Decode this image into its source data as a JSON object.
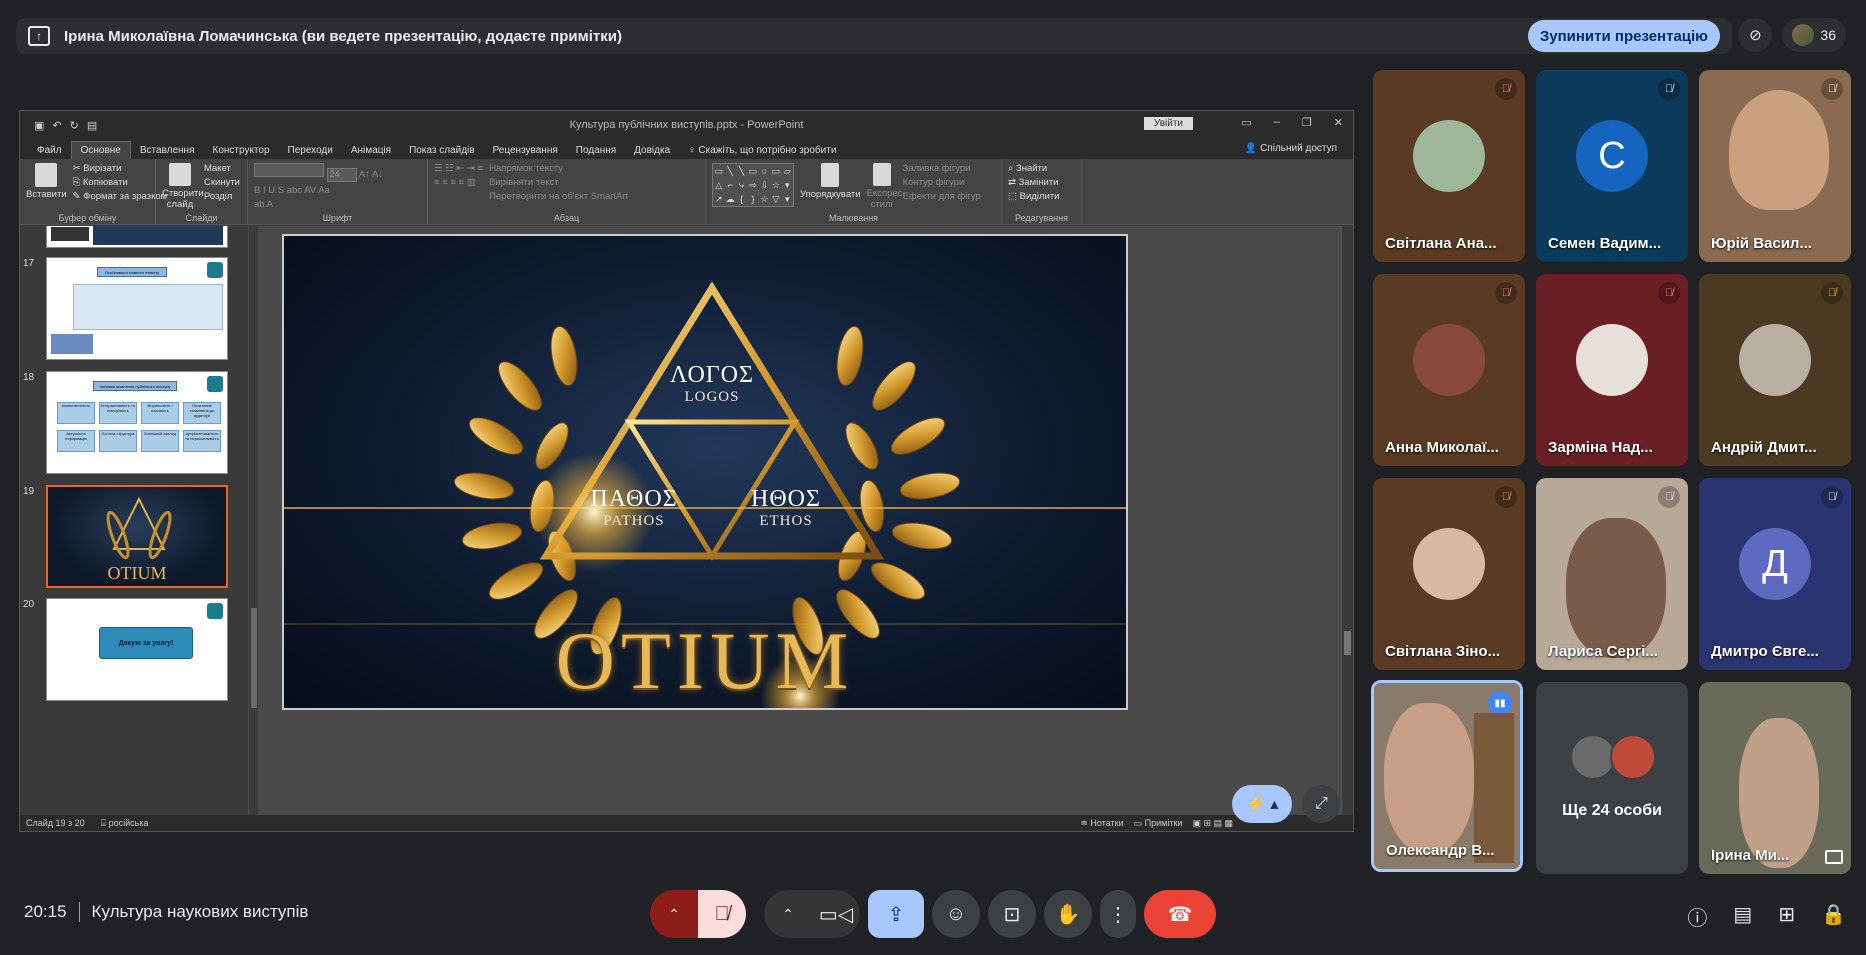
{
  "presentation_bar": {
    "text": "Ірина Миколаївна Ломачинська (ви ведете презентацію, додаєте примітки)",
    "stop_button": "Зупинити презентацію",
    "participant_count": "36"
  },
  "powerpoint": {
    "title": "Культура публічних виступів.pptx - PowerPoint",
    "sign_in": "Увійти",
    "tabs": [
      "Файл",
      "Основне",
      "Вставлення",
      "Конструктор",
      "Переходи",
      "Анімація",
      "Показ слайдів",
      "Рецензування",
      "Подання",
      "Довідка",
      "Скажіть, що потрібно зробити"
    ],
    "active_tab": "Основне",
    "share": "Спільний доступ",
    "ribbon": {
      "clipboard": {
        "paste": "Вставити",
        "cut": "Вирізати",
        "copy": "Копіювати",
        "format": "Формат за зразком",
        "group": "Буфер обміну"
      },
      "slides": {
        "new": "Створити слайд",
        "layout": "Макет",
        "reset": "Скинути",
        "section": "Розділ",
        "group": "Слайди"
      },
      "font": {
        "size": "24",
        "group": "Шрифт"
      },
      "paragraph": {
        "dir": "Напрямок тексту",
        "align": "Вирівняти текст",
        "smartart": "Перетворити на об'єкт SmartArt",
        "group": "Абзац"
      },
      "drawing": {
        "arrange": "Упорядкувати",
        "styles": "Експрес-стилі",
        "fill": "Заливка фігури",
        "outline": "Контур фігури",
        "effects": "Ефекти для фігур",
        "group": "Малювання"
      },
      "editing": {
        "find": "Знайти",
        "replace": "Замінити",
        "select": "Виділити",
        "group": "Редагування"
      }
    },
    "thumbnails": [
      {
        "num": "17",
        "title": "Особливості мовного етикету"
      },
      {
        "num": "18",
        "title": "Чинники мовлення публічного виступу",
        "cells": [
          "Компетентність",
          "Інтерактивність та емоційність",
          "Візуальність і наочність",
          "Позитивне ставлення до аудиторії",
          "Актуальна інформація",
          "Логічна структура",
          "Зовнішній вигляд",
          "Аргументованість та переконливість"
        ]
      },
      {
        "num": "19",
        "title": "OTIUM"
      },
      {
        "num": "20",
        "title": "Дякую за увагу!"
      }
    ],
    "slide": {
      "logos_gr": "ΛΟΓΟΣ",
      "logos_lat": "LOGOS",
      "pathos_gr": "ΠΑΘΟΣ",
      "pathos_lat": "PATHOS",
      "ethos_gr": "ΗΘΟΣ",
      "ethos_lat": "ETHOS",
      "word": "OTIUM"
    },
    "status": {
      "slide": "Слайд 19 з 20",
      "lang": "російська",
      "notes": "Нотатки",
      "comments": "Примітки"
    }
  },
  "participants": [
    {
      "name": "Світлана Ана...",
      "bg": "#5a3a22"
    },
    {
      "name": "Семен Вадим...",
      "bg": "#0c3a5a",
      "letter": "С",
      "letter_bg": "#1565c0"
    },
    {
      "name": "Юрій Васил...",
      "bg": "#8a6a50"
    },
    {
      "name": "Анна Миколаї...",
      "bg": "#5a3a22"
    },
    {
      "name": "Зарміна Над...",
      "bg": "#6a1f24"
    },
    {
      "name": "Андрій Дмит...",
      "bg": "#4a3a22"
    },
    {
      "name": "Світлана Зіно...",
      "bg": "#5a3a22"
    },
    {
      "name": "Лариса Сергі...",
      "bg": "#b8a898"
    },
    {
      "name": "Дмитро Євге...",
      "bg": "#2a3470",
      "letter": "Д",
      "letter_bg": "#5c6bc0"
    },
    {
      "name": "Олександр В...",
      "bg": "#8a7a6a"
    },
    {
      "name": "Ще 24 особи",
      "bg": "#3c4043"
    },
    {
      "name": "Ірина Ми...",
      "bg": "#6a6a5a"
    }
  ],
  "bottom": {
    "time": "20:15",
    "meeting": "Культура наукових виступів"
  }
}
